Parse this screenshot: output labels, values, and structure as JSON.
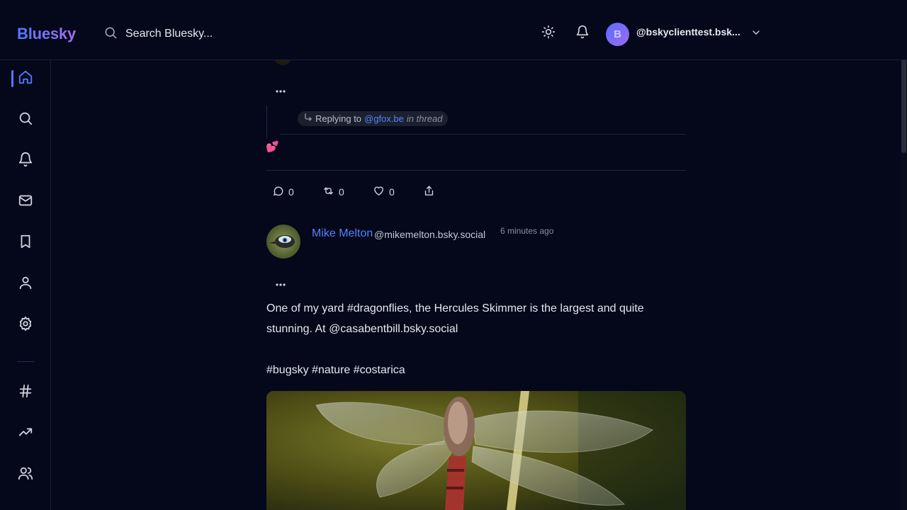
{
  "header": {
    "brand": "Bluesky",
    "search_placeholder": "Search Bluesky...",
    "account": {
      "avatar_initial": "B",
      "handle": "@bskyclienttest.bsk..."
    }
  },
  "sidebar": {
    "items": [
      {
        "name": "home",
        "icon": "home-icon",
        "active": true
      },
      {
        "name": "search",
        "icon": "search-icon"
      },
      {
        "name": "notifications",
        "icon": "bell-icon"
      },
      {
        "name": "messages",
        "icon": "mail-icon"
      },
      {
        "name": "bookmarks",
        "icon": "bookmark-icon"
      },
      {
        "name": "profile",
        "icon": "user-icon"
      },
      {
        "name": "settings",
        "icon": "gear-icon"
      },
      {
        "name": "hashtags",
        "icon": "hash-icon"
      },
      {
        "name": "trending",
        "icon": "trending-icon"
      },
      {
        "name": "people",
        "icon": "users-icon"
      }
    ]
  },
  "reply_post": {
    "replying_to_label": "Replying to",
    "replying_to_handle": "@gfox.be",
    "in_thread_label": "in thread",
    "emoji": "💕",
    "actions": {
      "replies": "0",
      "reposts": "0",
      "likes": "0"
    }
  },
  "post": {
    "author_name": "Mike Melton",
    "author_handle": "@mikemelton.bsky.social",
    "timestamp": "6 minutes ago",
    "text_line1": "One of my yard #dragonflies, the Hercules Skimmer is the largest and quite",
    "text_line2": "stunning. At @casabentbill.bsky.social",
    "tags": "#bugsky #nature #costarica"
  },
  "colors": {
    "background": "#05071a",
    "accent": "#4f7bff",
    "link": "#4f86ff",
    "muted": "#8a8fa1",
    "border": "#1c2033"
  }
}
